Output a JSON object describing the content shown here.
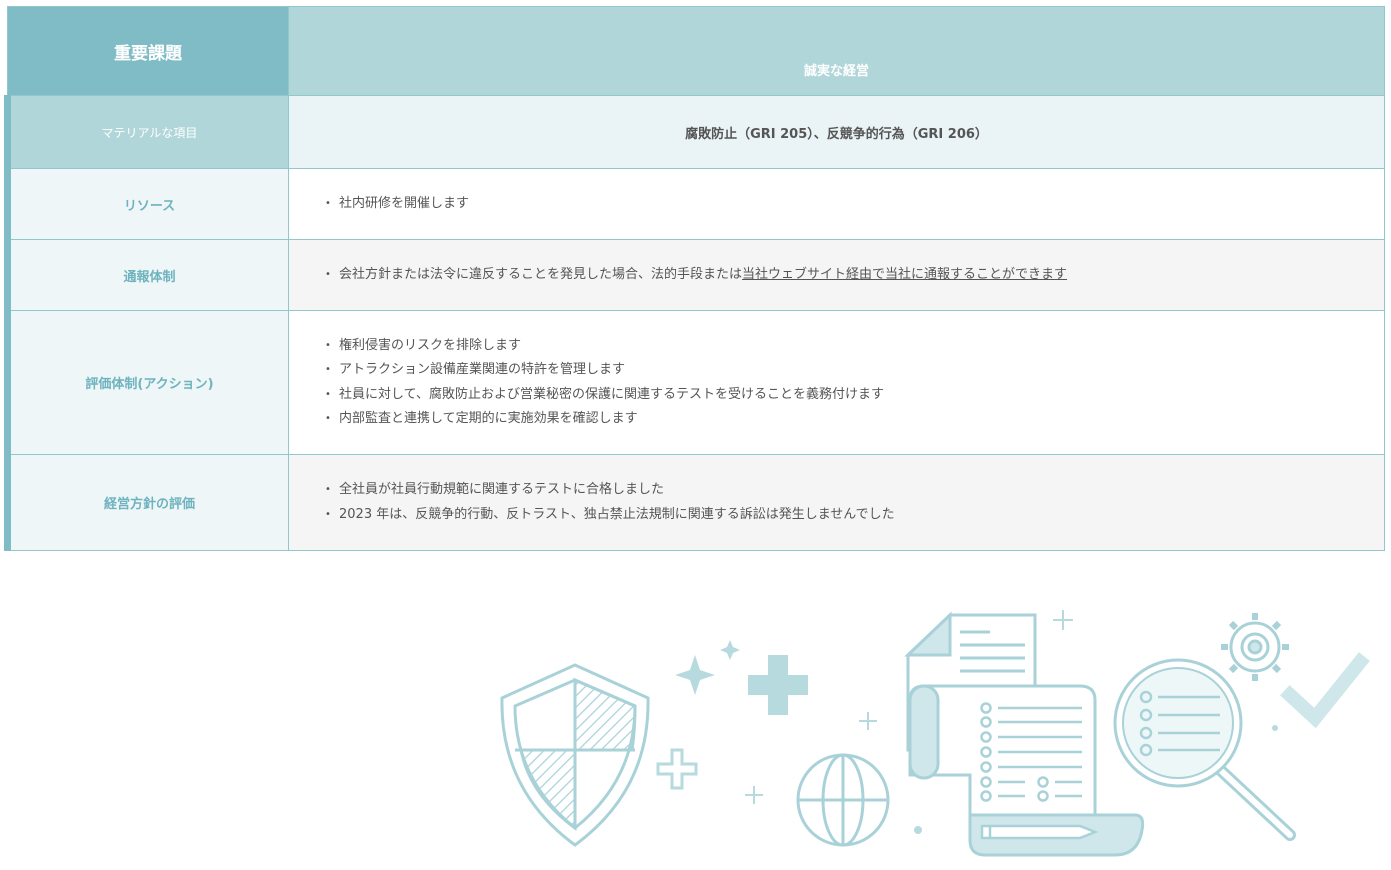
{
  "header": {
    "label": "重要課題",
    "value": "誠実な経営"
  },
  "rows": [
    {
      "label": "マテリアルな項目",
      "value": "腐敗防止（GRI 205）、反競争的行為（GRI 206）"
    },
    {
      "label": "リソース",
      "items": [
        "社内研修を開催します"
      ]
    },
    {
      "label": "通報体制",
      "item_prefix": "会社方針または法令に違反することを発見した場合、法的手段または",
      "item_link": "当社ウェブサイト経由で当社に通報することができます"
    },
    {
      "label": "評価体制(アクション)",
      "items": [
        "権利侵害のリスクを排除します",
        "アトラクション設備産業関連の特許を管理します",
        "社員に対して、腐敗防止および営業秘密の保護に関連するテストを受けることを義務付けます",
        "内部監査と連携して定期的に実施効果を確認します"
      ]
    },
    {
      "label": "経営方針の評価",
      "items": [
        "全社員が社員行動規範に関連するテストに合格しました",
        "2023 年は、反競争的行動、反トラスト、独占禁止法規制に関連する訴訟は発生しませんでした"
      ]
    }
  ],
  "colors": {
    "accent": "#80bcc5",
    "accent_light": "#b0d6da",
    "label_text": "#6fb3bf",
    "border": "#94c6cd"
  },
  "illustration": {
    "icons": [
      "shield-icon",
      "sparkle-icon",
      "plus-icon",
      "globe-icon",
      "document-icon",
      "checklist-scroll-icon",
      "pencil-icon",
      "magnifier-icon",
      "gear-icon",
      "checkmark-icon"
    ]
  }
}
